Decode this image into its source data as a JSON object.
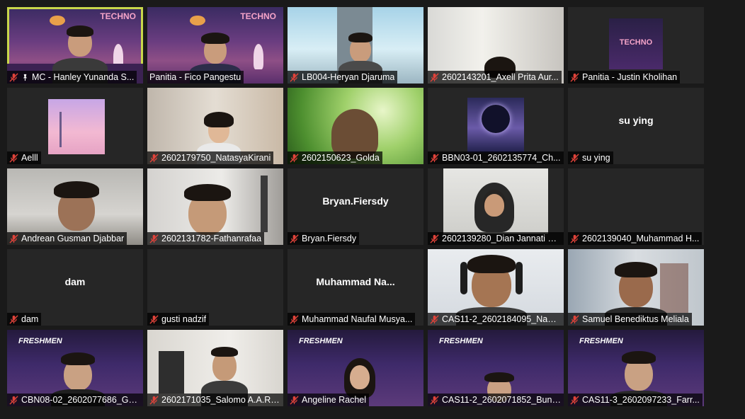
{
  "colors": {
    "active_border": "#c9d84b",
    "muted_mic": "#e0433a",
    "tile_bg": "#262626",
    "nameplate_bg": "#000000"
  },
  "participants": [
    {
      "label": "MC - Hanley Yunanda S...",
      "pinned": true,
      "active": true,
      "video": true
    },
    {
      "label": "Panitia - Fico Pangestu",
      "video": true
    },
    {
      "label": "LB004-Heryan Djaruma",
      "video": true
    },
    {
      "label": "2602143201_Axell Prita Aur...",
      "video": true
    },
    {
      "label": "Panitia - Justin Kholihan",
      "video": true
    },
    {
      "label": "Aelll",
      "video": true
    },
    {
      "label": "2602179750_NatasyaKirani",
      "video": true
    },
    {
      "label": "2602150623_Golda",
      "video": true
    },
    {
      "label": "BBN03-01_2602135774_Ch...",
      "video": true
    },
    {
      "label": "su ying",
      "center_name": "su ying",
      "video": false
    },
    {
      "label": "Andrean Gusman Djabbar",
      "video": true
    },
    {
      "label": "2602131782-Fathanrafaa",
      "video": true
    },
    {
      "label": "Bryan.Fiersdy",
      "center_name": "Bryan.Fiersdy",
      "video": false
    },
    {
      "label": "2602139280_Dian Jannati K...",
      "video": true
    },
    {
      "label": "2602139040_Muhammad H...",
      "video": false
    },
    {
      "label": "dam",
      "center_name": "dam",
      "video": false
    },
    {
      "label": "gusti nadzif",
      "video": false
    },
    {
      "label": "Muhammad Naufal Musya...",
      "center_name": "Muhammad  Na...",
      "video": false
    },
    {
      "label": "CAS11-2_2602184095_Nauf...",
      "video": true
    },
    {
      "label": "Samuel Benediktus Meliala",
      "video": true
    },
    {
      "label": "CBN08-02_2602077686_Gri...",
      "video": true
    },
    {
      "label": "2602171035_Salomo A.A.R....",
      "video": true
    },
    {
      "label": "Angeline Rachel",
      "video": true
    },
    {
      "label": "CAS11-2_2602071852_Bun ...",
      "video": true
    },
    {
      "label": "CAS11-3_2602097233_Farr...",
      "video": true
    }
  ],
  "overlays": {
    "techno_logo": "TECHNO",
    "freshmen_logo": "FRESHMEN"
  }
}
